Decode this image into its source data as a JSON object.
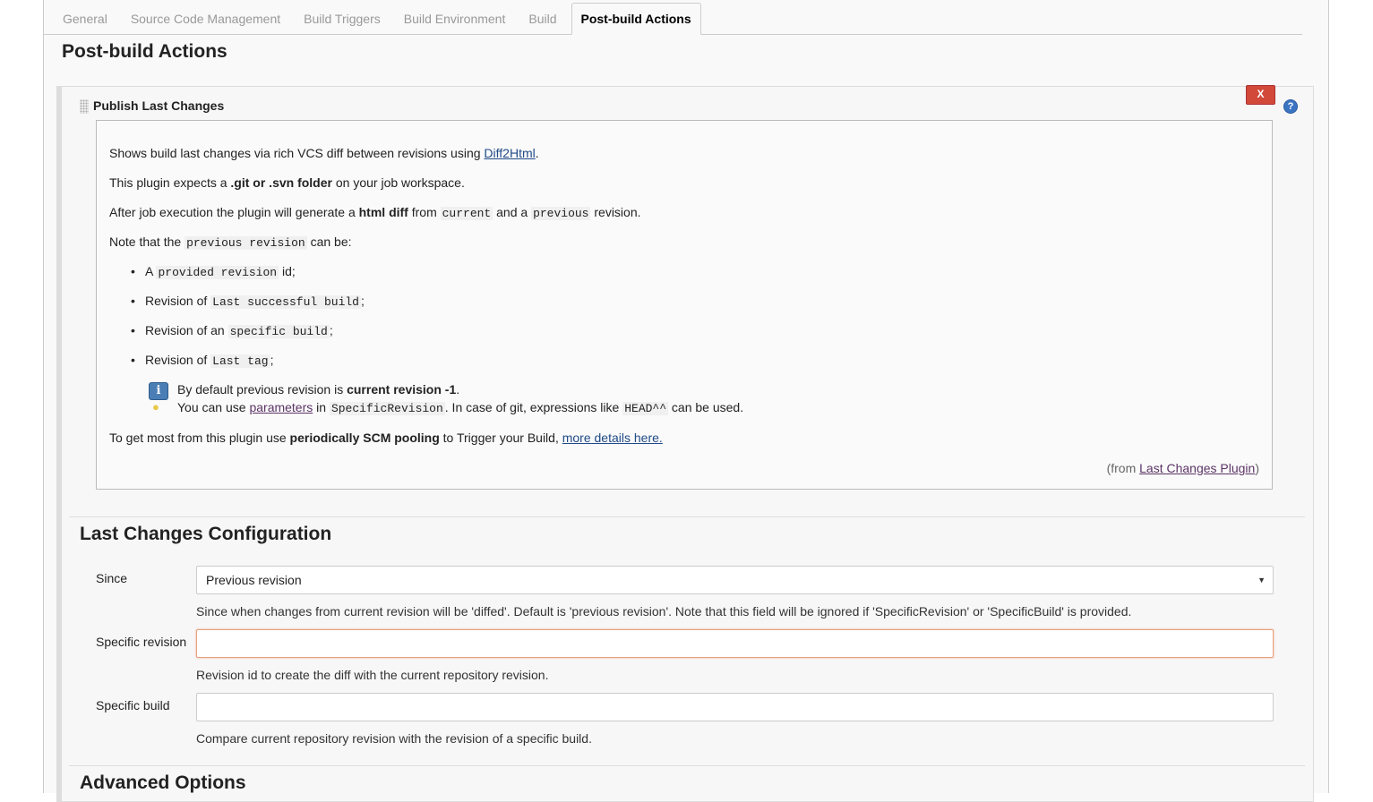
{
  "tabs": [
    {
      "label": "General"
    },
    {
      "label": "Source Code Management"
    },
    {
      "label": "Build Triggers"
    },
    {
      "label": "Build Environment"
    },
    {
      "label": "Build"
    },
    {
      "label": "Post-build Actions"
    }
  ],
  "section_title": "Post-build Actions",
  "plugin_block": {
    "title": "Publish Last Changes",
    "delete_label": "X",
    "help_label": "?"
  },
  "help": {
    "p1_a": "Shows build last changes via rich VCS diff between revisions using ",
    "p1_link": "Diff2Html",
    "p1_b": ".",
    "p2_a": "This plugin expects a ",
    "p2_bold": ".git or .svn folder",
    "p2_b": " on your job workspace.",
    "p3_a": "After job execution the plugin will generate a ",
    "p3_bold": "html diff",
    "p3_b": " from ",
    "p3_code1": "current",
    "p3_c": " and a ",
    "p3_code2": "previous",
    "p3_d": " revision.",
    "p4_a": "Note that the ",
    "p4_code": "previous revision",
    "p4_b": " can be:",
    "b1_a": "A ",
    "b1_code": "provided revision",
    "b1_b": " id;",
    "b2_a": "Revision of ",
    "b2_code": "Last successful build",
    "b2_b": ";",
    "b3_a": "Revision of an ",
    "b3_code": "specific build",
    "b3_b": ";",
    "b4_a": "Revision of ",
    "b4_code": "Last tag",
    "b4_b": ";",
    "n1_a": "By default previous revision is ",
    "n1_bold": "current revision -1",
    "n1_b": ".",
    "n2_a": "You can use ",
    "n2_link": "parameters",
    "n2_b": " in ",
    "n2_code1": "SpecificRevision",
    "n2_c": ". In case of git, expressions like ",
    "n2_code2": "HEAD^^",
    "n2_d": " can be used.",
    "p5_a": "To get most from this plugin use ",
    "p5_bold": "periodically SCM pooling",
    "p5_b": " to Trigger your Build, ",
    "p5_link": "more details here.",
    "from_a": "(from ",
    "from_link": "Last Changes Plugin",
    "from_b": ")"
  },
  "config": {
    "title": "Last Changes Configuration",
    "since_label": "Since",
    "since_value": "Previous revision",
    "since_desc": "Since when changes from current revision will be 'diffed'. Default is 'previous revision'. Note that this field will be ignored if 'SpecificRevision' or 'SpecificBuild' is provided.",
    "specific_revision_label": "Specific revision",
    "specific_revision_value": "",
    "specific_revision_desc": "Revision id to create the diff with the current repository revision.",
    "specific_build_label": "Specific build",
    "specific_build_value": "",
    "specific_build_desc": "Compare current repository revision with the revision of a specific build."
  },
  "advanced_title": "Advanced Options"
}
